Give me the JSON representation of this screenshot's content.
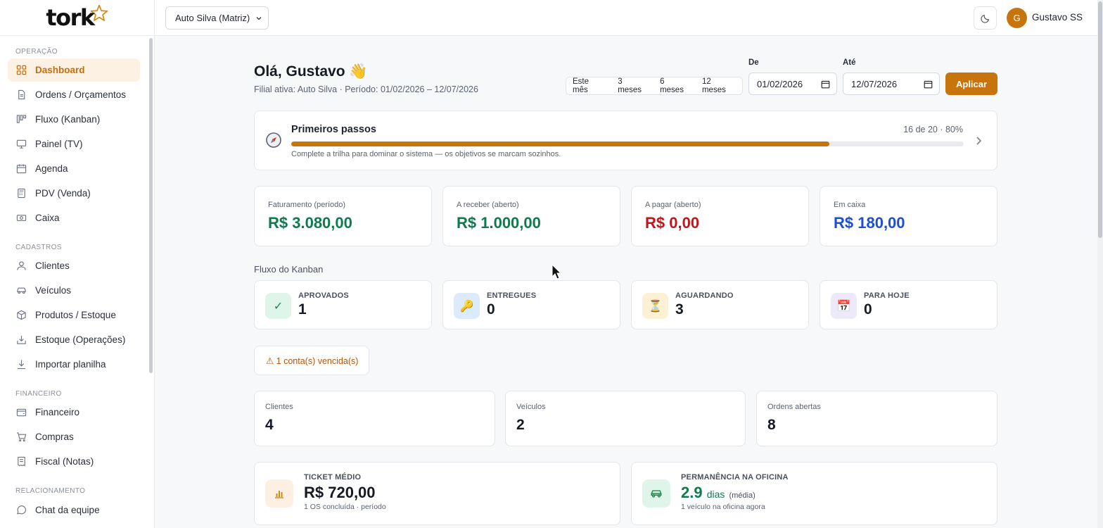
{
  "brand": {
    "logo_text": "tork"
  },
  "sidebar": {
    "sections": [
      {
        "label": "OPERAÇÃO"
      },
      {
        "label": "CADASTROS"
      },
      {
        "label": "FINANCEIRO"
      },
      {
        "label": "RELACIONAMENTO"
      }
    ],
    "items": [
      {
        "label": "Dashboard",
        "icon": "grid-icon",
        "active": true
      },
      {
        "label": "Ordens / Orçamentos",
        "icon": "document-icon"
      },
      {
        "label": "Fluxo (Kanban)",
        "icon": "kanban-icon"
      },
      {
        "label": "Painel (TV)",
        "icon": "monitor-icon"
      },
      {
        "label": "Agenda",
        "icon": "calendar-icon"
      },
      {
        "label": "PDV (Venda)",
        "icon": "pos-icon"
      },
      {
        "label": "Caixa",
        "icon": "cash-icon"
      },
      {
        "label": "Clientes",
        "icon": "user-icon"
      },
      {
        "label": "Veículos",
        "icon": "car-icon"
      },
      {
        "label": "Produtos / Estoque",
        "icon": "box-icon"
      },
      {
        "label": "Estoque (Operações)",
        "icon": "inbox-icon"
      },
      {
        "label": "Importar planilha",
        "icon": "download-icon"
      },
      {
        "label": "Financeiro",
        "icon": "wallet-icon"
      },
      {
        "label": "Compras",
        "icon": "cart-icon"
      },
      {
        "label": "Fiscal (Notas)",
        "icon": "receipt-icon"
      },
      {
        "label": "Chat da equipe",
        "icon": "chat-icon"
      }
    ]
  },
  "topbar": {
    "branch_select": "Auto Silva (Matriz)",
    "user_initial": "G",
    "user_name": "Gustavo SS"
  },
  "header": {
    "greeting": "Olá, Gustavo 👋",
    "subinfo": "Filial ativa: Auto Silva · Período: 01/02/2026 – 12/07/2026",
    "presets": [
      "Este mês",
      "3 meses",
      "6 meses",
      "12 meses"
    ],
    "from_label": "De",
    "from_value": "01/02/2026",
    "to_label": "Até",
    "to_value": "12/07/2026",
    "apply_label": "Aplicar"
  },
  "onboarding": {
    "title": "Primeiros passos",
    "progress_text": "16 de 20 · 80%",
    "progress": 0.8,
    "description": "Complete a trilha para dominar o sistema — os objetivos se marcam sozinhos."
  },
  "kpis": [
    {
      "label": "Faturamento (período)",
      "value": "R$ 3.080,00",
      "color": "#0f7a4e"
    },
    {
      "label": "A receber (aberto)",
      "value": "R$ 1.000,00",
      "color": "#0f7a4e"
    },
    {
      "label": "A pagar (aberto)",
      "value": "R$ 0,00",
      "color": "#c4141c"
    },
    {
      "label": "Em caixa",
      "value": "R$ 180,00",
      "color": "#1f4fd1"
    }
  ],
  "kanban": {
    "title": "Fluxo do Kanban",
    "cards": [
      {
        "label": "APROVADOS",
        "value": "1",
        "icon": "check-icon",
        "glyph": "✓",
        "bg": "#dff5e9",
        "fg": "#1b8a4c"
      },
      {
        "label": "ENTREGUES",
        "value": "0",
        "icon": "key-icon",
        "glyph": "🔑",
        "bg": "#dcebfb",
        "fg": "#2b6cc4"
      },
      {
        "label": "AGUARDANDO",
        "value": "3",
        "icon": "hourglass-icon",
        "glyph": "⏳",
        "bg": "#fdf1d3",
        "fg": "#b5830a"
      },
      {
        "label": "PARA HOJE",
        "value": "0",
        "icon": "calendar-icon",
        "glyph": "📅",
        "bg": "#ece9fb",
        "fg": "#6a55c9"
      }
    ]
  },
  "alert": {
    "text": "⚠ 1 conta(s) vencida(s)"
  },
  "counts": [
    {
      "label": "Clientes",
      "value": "4"
    },
    {
      "label": "Veículos",
      "value": "2"
    },
    {
      "label": "Ordens abertas",
      "value": "8"
    }
  ],
  "metrics": [
    {
      "label": "TICKET MÉDIO",
      "value": "R$ 720,00",
      "sub": "1 OS concluída · período",
      "icon": "bar-chart-icon",
      "bg": "#fdf0e3"
    },
    {
      "label": "PERMANÊNCIA NA OFICINA",
      "value": "2.9",
      "unit": "dias",
      "unit_note": "(média)",
      "sub": "1 veículo na oficina agora",
      "icon": "car-icon",
      "bg": "#dff5e9",
      "value_color": "#0f7a4e"
    }
  ]
}
